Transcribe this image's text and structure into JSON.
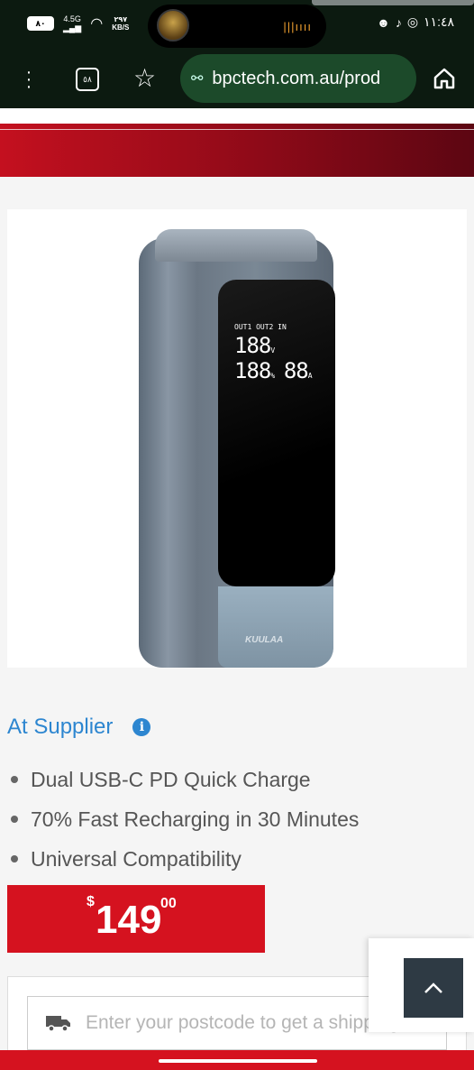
{
  "status_bar": {
    "battery": "٨٠",
    "network": "4.5G",
    "speed_value": "٢٩٧",
    "speed_unit": "KB/S",
    "time": "١١:٤٨"
  },
  "browser": {
    "tab_count": "٥٨",
    "url": "bpctech.com.au/prod"
  },
  "product": {
    "lcd_labels": "OUT1 OUT2 IN",
    "lcd_volts": "188",
    "lcd_volts_unit": "V",
    "lcd_percent": "188",
    "lcd_amps": "88",
    "lcd_amps_unit": "A",
    "brand": "KUULAA"
  },
  "supplier": {
    "label": "At Supplier"
  },
  "features": [
    "Dual USB-C PD Quick Charge",
    "70% Fast Recharging in 30 Minutes",
    "Universal Compatibility"
  ],
  "price": {
    "currency": "$",
    "dollars": "149",
    "cents": "00"
  },
  "shipping": {
    "placeholder": "Enter your postcode to get a shipping"
  },
  "colors": {
    "brand_red": "#d5121f",
    "link_blue": "#2d86d0",
    "toolbar_bg": "#0c1a10"
  }
}
